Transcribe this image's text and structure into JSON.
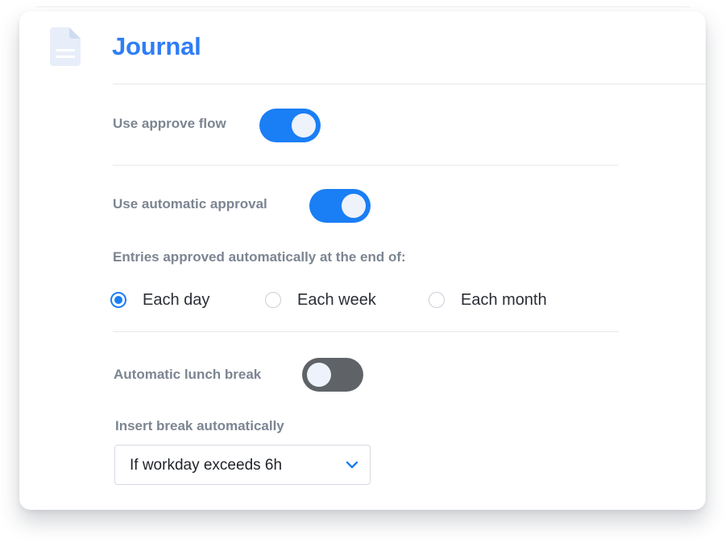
{
  "section": {
    "title": "Journal",
    "icon": "document-icon"
  },
  "approve_flow": {
    "label": "Use approve flow",
    "enabled": true
  },
  "automatic_approval": {
    "label": "Use automatic approval",
    "enabled": true,
    "entries_label": "Entries approved automatically at the end of:",
    "options": [
      {
        "label": "Each day",
        "selected": true
      },
      {
        "label": "Each week",
        "selected": false
      },
      {
        "label": "Each month",
        "selected": false
      }
    ]
  },
  "lunch_break": {
    "label": "Automatic lunch break",
    "enabled": false,
    "insert_label": "Insert break automatically",
    "selected_value": "If workday exceeds 6h"
  },
  "colors": {
    "accent": "#2f7df6",
    "toggle_on": "#1a7ef5",
    "toggle_off": "#5f6368",
    "label": "#7c8592"
  }
}
